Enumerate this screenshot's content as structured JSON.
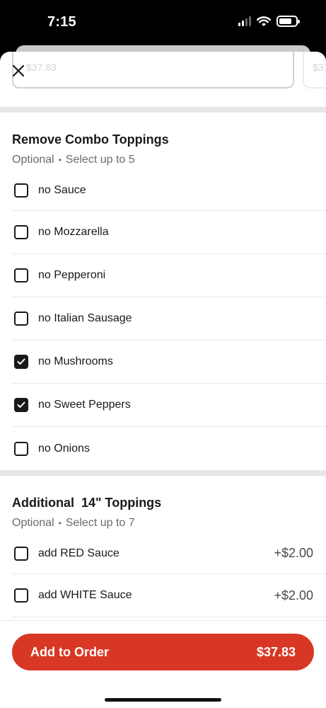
{
  "status_bar": {
    "time": "7:15"
  },
  "header": {
    "ghost_price": "$37.83",
    "ghost_price_2": "$37"
  },
  "sections": [
    {
      "title": "Remove Combo Toppings",
      "optional": "Optional",
      "limit": "Select up to 5",
      "options": [
        {
          "label": "no Sauce",
          "checked": false
        },
        {
          "label": "no Mozzarella",
          "checked": false
        },
        {
          "label": "no Pepperoni",
          "checked": false
        },
        {
          "label": "no Italian Sausage",
          "checked": false
        },
        {
          "label": "no Mushrooms",
          "checked": true
        },
        {
          "label": "no Sweet Peppers",
          "checked": true
        },
        {
          "label": "no Onions",
          "checked": false
        }
      ]
    },
    {
      "title": "Additional  14\" Toppings",
      "optional": "Optional",
      "limit": "Select up to 7",
      "options": [
        {
          "label": "add RED Sauce",
          "price": "+$2.00",
          "checked": false
        },
        {
          "label": "add WHITE Sauce",
          "price": "+$2.00",
          "checked": false
        }
      ]
    }
  ],
  "footer": {
    "button_label": "Add to Order",
    "button_price": "$37.83"
  },
  "colors": {
    "accent": "#d93725",
    "text": "#191919",
    "muted": "#6b6b6b",
    "band": "#e6e6e6"
  },
  "icons": {
    "close": "close-icon",
    "check": "checkmark-icon",
    "wifi": "wifi-icon",
    "signal": "signal-icon",
    "battery": "battery-icon"
  }
}
